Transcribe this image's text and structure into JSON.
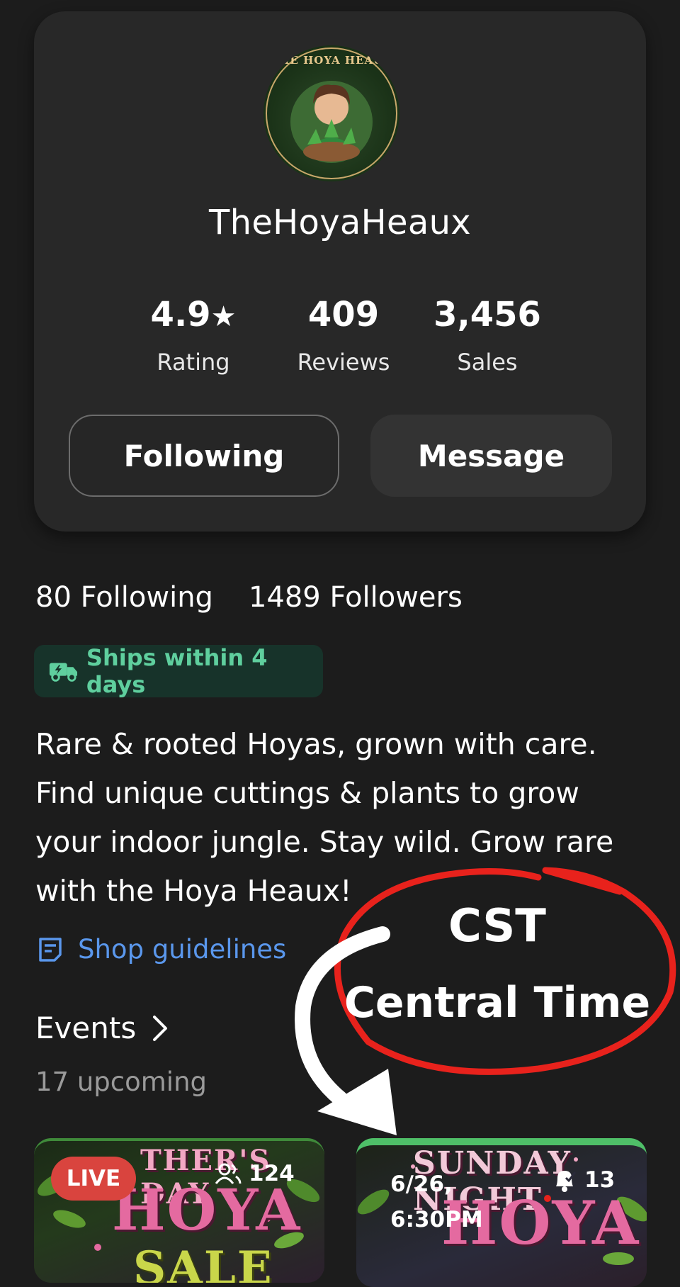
{
  "profile": {
    "avatar_text": "THE HOYA HEAUX",
    "name": "TheHoyaHeaux",
    "rating_value": "4.9",
    "rating_label": "Rating",
    "reviews_value": "409",
    "reviews_label": "Reviews",
    "sales_value": "3,456",
    "sales_label": "Sales"
  },
  "actions": {
    "following_label": "Following",
    "message_label": "Message"
  },
  "social": {
    "following_text": "80 Following",
    "followers_text": "1489 Followers"
  },
  "shipping_badge": {
    "icon": "truck-fast-icon",
    "label": "Ships within 4 days",
    "color": "#5fcf9e"
  },
  "bio": {
    "lines": [
      "Rare & rooted Hoyas, grown with care.",
      "Find unique cuttings & plants to grow",
      "your indoor jungle. Stay wild. Grow rare",
      "with the Hoya Heaux!"
    ]
  },
  "shop_guidelines": {
    "icon": "document-icon",
    "label": "Shop guidelines",
    "color": "#5a97ec"
  },
  "events": {
    "title": "Events",
    "upcoming": "17 upcoming",
    "cards": [
      {
        "badge": "LIVE",
        "viewers": "124",
        "art_line1": "THER'S DAY",
        "art_line2": "HOYA",
        "art_line3": "SALE"
      },
      {
        "date": "6/26,",
        "time": "6:30PM",
        "reminders": "13",
        "art_line1": "SUNDAY NIGHT",
        "art_line2": "HOYA"
      }
    ]
  },
  "annotation": {
    "line1": "CST",
    "line2": "Central Time",
    "circle_color": "#e8221c",
    "arrow_color": "#ffffff"
  }
}
